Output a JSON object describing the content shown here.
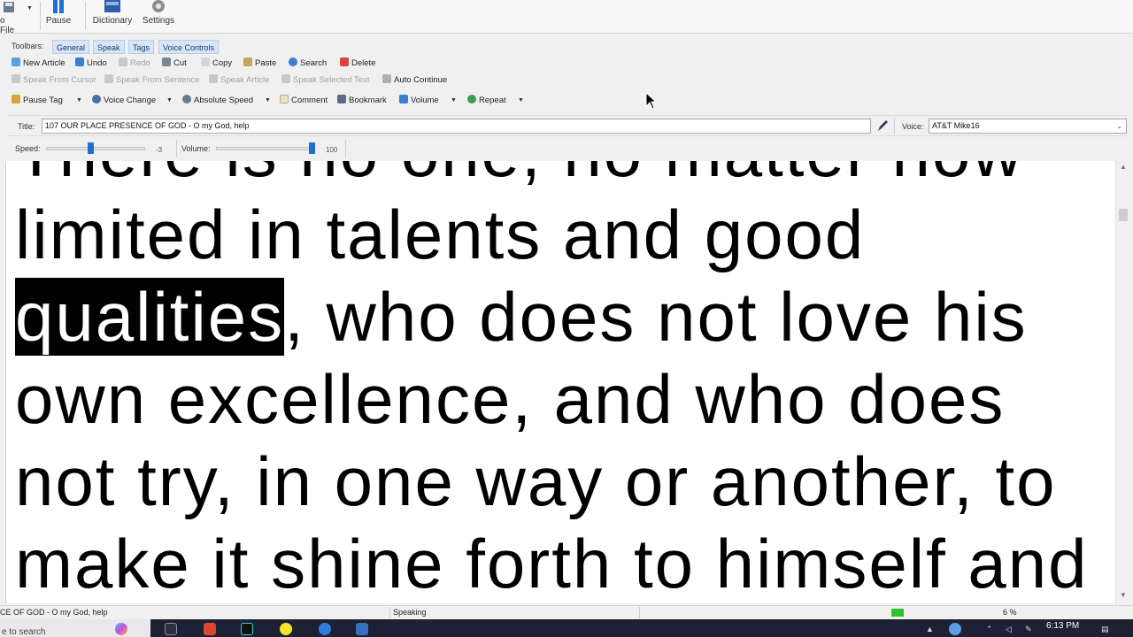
{
  "ribbon": {
    "file_label": "o File",
    "pause_label": "Pause",
    "dictionary_label": "Dictionary",
    "settings_label": "Settings"
  },
  "toolbars": {
    "label": "Toolbars:",
    "tabs": [
      "General",
      "Speak",
      "Tags",
      "Voice Controls"
    ]
  },
  "general_toolbar": {
    "new_article": "New Article",
    "undo": "Undo",
    "redo": "Redo",
    "cut": "Cut",
    "copy": "Copy",
    "paste": "Paste",
    "search": "Search",
    "delete": "Delete"
  },
  "speak_toolbar": {
    "speak_from_cursor": "Speak From Cursor",
    "speak_from_sentence": "Speak From Sentence",
    "speak_article": "Speak Article",
    "speak_selected_text": "Speak Selected Text",
    "auto_continue": "Auto Continue"
  },
  "tags_toolbar": {
    "pause_tag": "Pause Tag",
    "voice_change": "Voice Change",
    "absolute_speed": "Absolute Speed",
    "comment": "Comment",
    "bookmark": "Bookmark",
    "volume": "Volume",
    "repeat": "Repeat"
  },
  "title_row": {
    "title_label": "Title:",
    "title_value": "107 OUR PLACE PRESENCE OF GOD - O my God, help",
    "voice_label": "Voice:",
    "voice_value": "AT&T Mike16"
  },
  "controls": {
    "speed_label": "Speed:",
    "speed_value": "-3",
    "speed_level": 0.45,
    "volume_label": "Volume:",
    "volume_value": "100",
    "volume_level": 1.0
  },
  "reader": {
    "line1": "There is no one, no matter how",
    "line2": "limited in talents and good",
    "line3_highlight": "qualities",
    "line3_rest": ", who does not love his",
    "line4": "own excellence, and who does",
    "line5": "not try, in one way or another, to",
    "line6": "make it shine forth to himself and"
  },
  "status_bar": {
    "article": "CE OF GOD - O my God, help",
    "state": "Speaking",
    "progress_percent": "6 %"
  },
  "taskbar": {
    "search_placeholder": "e to search",
    "clock": "6:13 PM"
  }
}
